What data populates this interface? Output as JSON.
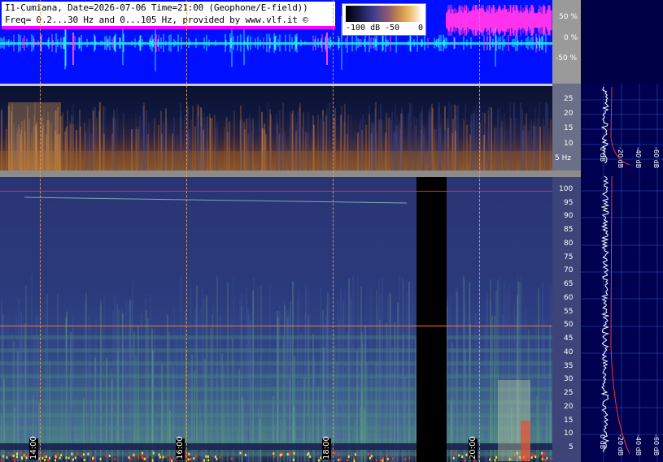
{
  "header": {
    "line1": "I1-Cumiana, Date=2026-07-06 Time=21:00 (Geophone/E-field))",
    "line2": "Freq= 0.2...30 Hz and 0...105 Hz, provided by www.vlf.it ©"
  },
  "scale": {
    "min_label": "-100 dB",
    "mid_label": "-50",
    "max_label": "0"
  },
  "waveform_axis": {
    "labels": [
      "50 %",
      "0 %",
      "-50 %"
    ]
  },
  "low_axis": {
    "labels": [
      "25",
      "20",
      "15",
      "10",
      "5 Hz"
    ]
  },
  "main_axis": {
    "labels": [
      "100",
      "95",
      "90",
      "85",
      "80",
      "75",
      "70",
      "65",
      "60",
      "55",
      "50",
      "45",
      "40",
      "35",
      "30",
      "25",
      "20",
      "15",
      "10",
      "5"
    ]
  },
  "time_markers": [
    "14:00",
    "16:00",
    "18:00",
    "20:00"
  ],
  "db_labels_low": [
    "0 dB",
    "-20 dB",
    "-40 dB",
    "-60 dB"
  ],
  "db_labels_main": [
    "0 dB",
    "-20 dB",
    "-40 dB",
    "-60 dB"
  ],
  "colors": {
    "waveform_bg": "#0010ff",
    "waveform_trace": "#22d6ff",
    "header_border": "#ff00ff",
    "marker_line": "#e6a050",
    "mains_hum": "#ff2020"
  }
}
